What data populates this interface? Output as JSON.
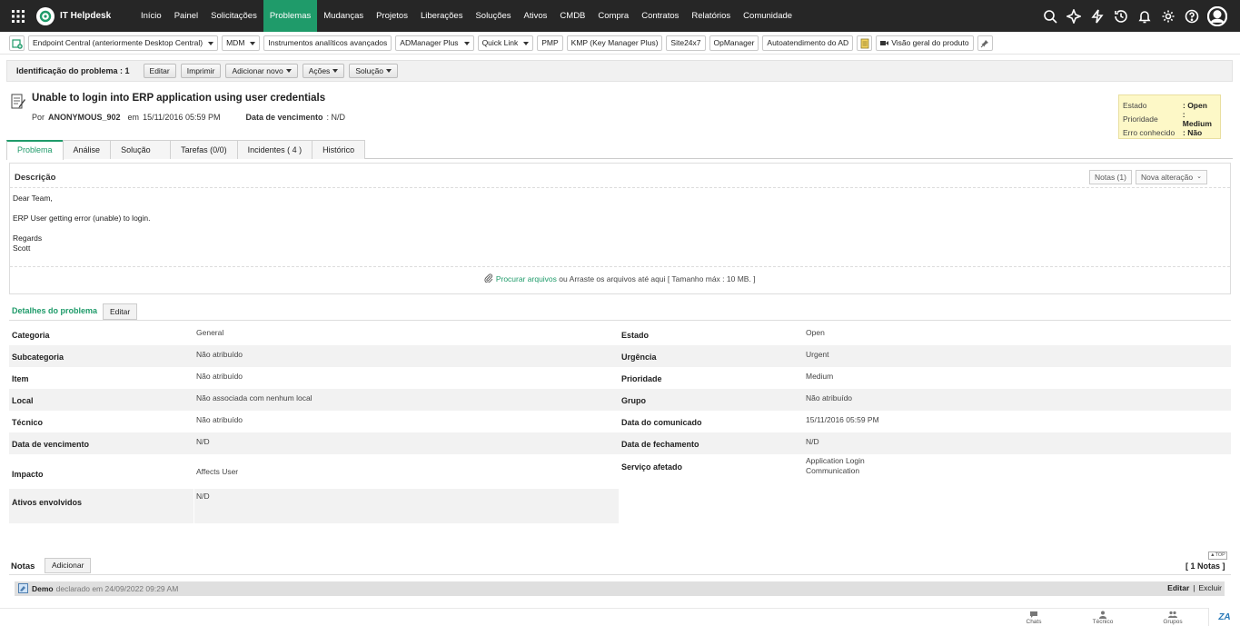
{
  "nav": {
    "app_title": "IT Helpdesk",
    "items": [
      "Início",
      "Painel",
      "Solicitações",
      "Problemas",
      "Mudanças",
      "Projetos",
      "Liberações",
      "Soluções",
      "Ativos",
      "CMDB",
      "Compra",
      "Contratos",
      "Relatórios",
      "Comunidade"
    ],
    "active": "Problemas"
  },
  "linkbar": {
    "items": [
      {
        "label": "Endpoint Central (anteriormente Desktop Central)",
        "dropdown": true
      },
      {
        "label": "MDM",
        "dropdown": true
      },
      {
        "label": "Instrumentos analíticos avançados",
        "dropdown": false
      },
      {
        "label": "ADManager Plus",
        "dropdown": true
      },
      {
        "label": "Quick Link",
        "dropdown": true
      },
      {
        "label": "PMP",
        "dropdown": false
      },
      {
        "label": "KMP (Key Manager Plus)",
        "dropdown": false
      },
      {
        "label": "Site24x7",
        "dropdown": false
      },
      {
        "label": "OpManager",
        "dropdown": false
      },
      {
        "label": "Autoatendimento do AD",
        "dropdown": false
      }
    ],
    "product_overview": "Visão geral do produto"
  },
  "actionbar": {
    "problem_id": "Identificação do problema : 1",
    "edit": "Editar",
    "print": "Imprimir",
    "add_new": "Adicionar novo",
    "actions": "Ações",
    "solution": "Solução"
  },
  "problem": {
    "title": "Unable to login into ERP application using user credentials",
    "by_label": "Por",
    "author": "ANONYMOUS_902",
    "on_label": "em",
    "date": "15/11/2016 05:59 PM",
    "due_label": "Data de vencimento",
    "due_value": ": N/D"
  },
  "status_box": {
    "rows": [
      {
        "key": "Estado",
        "value": ": Open"
      },
      {
        "key": "Prioridade",
        "value": ": Medium"
      },
      {
        "key": "Erro conhecido",
        "value": ": Não"
      }
    ]
  },
  "tabs": [
    "Problema",
    "Análise",
    "Solução",
    "Tarefas (0/0)",
    "Incidentes ( 4 )",
    "Histórico"
  ],
  "description": {
    "heading": "Descrição",
    "notes_btn": "Notas (1)",
    "new_change_btn": "Nova alteração",
    "greeting": "Dear Team,",
    "body": "ERP User getting error (unable) to login.",
    "regards": "Regards",
    "signature": "Scott",
    "attach_link": "Procurar arquivos",
    "attach_text": "ou Arraste os arquivos até aqui [ Tamanho máx : 10 MB. ]"
  },
  "details": {
    "heading": "Detalhes do problema",
    "edit": "Editar",
    "left": [
      {
        "key": "Categoria",
        "value": "General"
      },
      {
        "key": "Subcategoria",
        "value": "Não atribuído"
      },
      {
        "key": "Item",
        "value": "Não atribuído"
      },
      {
        "key": "Local",
        "value": "Não associada com nenhum local"
      },
      {
        "key": "Técnico",
        "value": "Não atribuído"
      },
      {
        "key": "Data de vencimento",
        "value": "N/D"
      },
      {
        "key": "Impacto",
        "value": "Affects User"
      },
      {
        "key": "Ativos envolvidos",
        "value": "N/D"
      }
    ],
    "right": [
      {
        "key": "Estado",
        "value": "Open"
      },
      {
        "key": "Urgência",
        "value": "Urgent"
      },
      {
        "key": "Prioridade",
        "value": "Medium"
      },
      {
        "key": "Grupo",
        "value": "Não atribuído"
      },
      {
        "key": "Data do comunicado",
        "value": "15/11/2016 05:59 PM"
      },
      {
        "key": "Data de fechamento",
        "value": "N/D"
      },
      {
        "key": "Serviço afetado",
        "value": "Application Login",
        "value2": "Communication"
      }
    ]
  },
  "notes": {
    "heading": "Notas",
    "add": "Adicionar",
    "count": "[ 1 Notas ]",
    "top": "▲TOP",
    "author": "Demo",
    "declared": "declarado em 24/09/2022 09:29 AM",
    "edit": "Editar",
    "separator": "|",
    "delete": "Excluir"
  },
  "bottombar": {
    "chats": "Chats",
    "tech": "Técnico",
    "groups": "Grupos"
  },
  "colors": {
    "accent": "#1f9b6a",
    "topbar": "#262626",
    "status_box": "#fdf8c7"
  }
}
